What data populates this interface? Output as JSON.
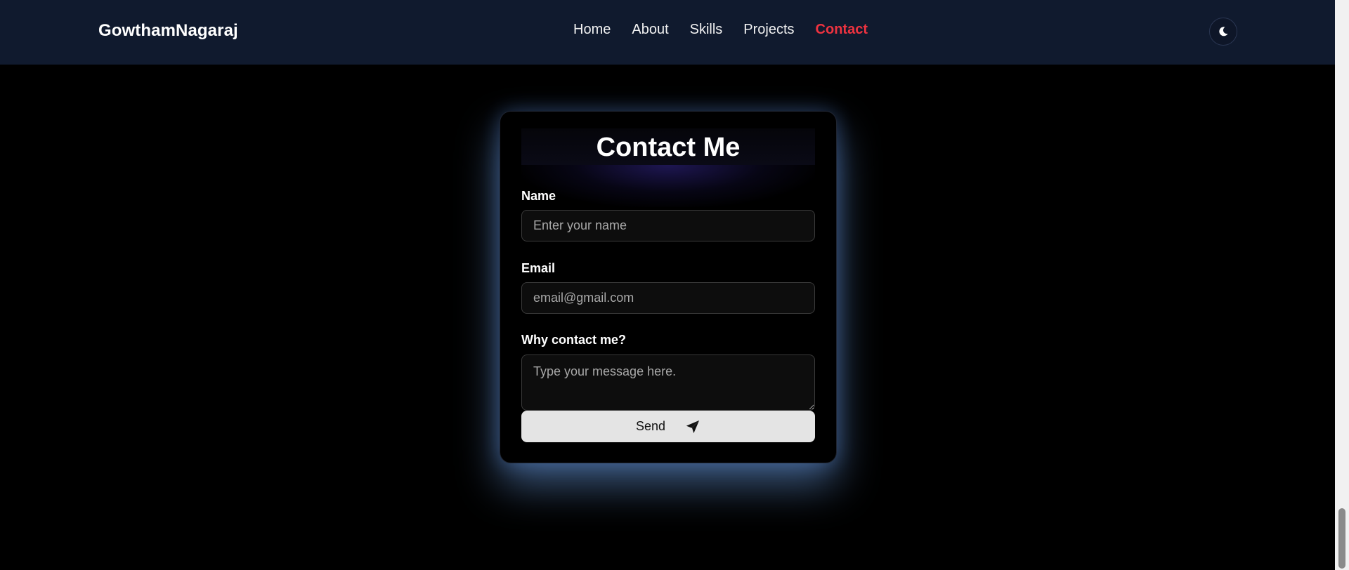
{
  "navbar": {
    "brand": "GowthamNagaraj",
    "links": [
      {
        "label": "Home",
        "active": false
      },
      {
        "label": "About",
        "active": false
      },
      {
        "label": "Skills",
        "active": false
      },
      {
        "label": "Projects",
        "active": false
      },
      {
        "label": "Contact",
        "active": true
      }
    ],
    "theme_toggle_icon": "moon-icon"
  },
  "contact_form": {
    "title": "Contact Me",
    "name_label": "Name",
    "name_placeholder": "Enter your name",
    "email_label": "Email",
    "email_placeholder": "email@gmail.com",
    "message_label": "Why contact me?",
    "message_placeholder": "Type your message here.",
    "send_label": "Send",
    "send_icon": "paper-plane-icon"
  },
  "colors": {
    "nav_background": "#101a2e",
    "active_link": "#ef3340",
    "page_background": "#000000",
    "card_glow": "#6ea0e6",
    "button_background": "#e4e4e4"
  }
}
